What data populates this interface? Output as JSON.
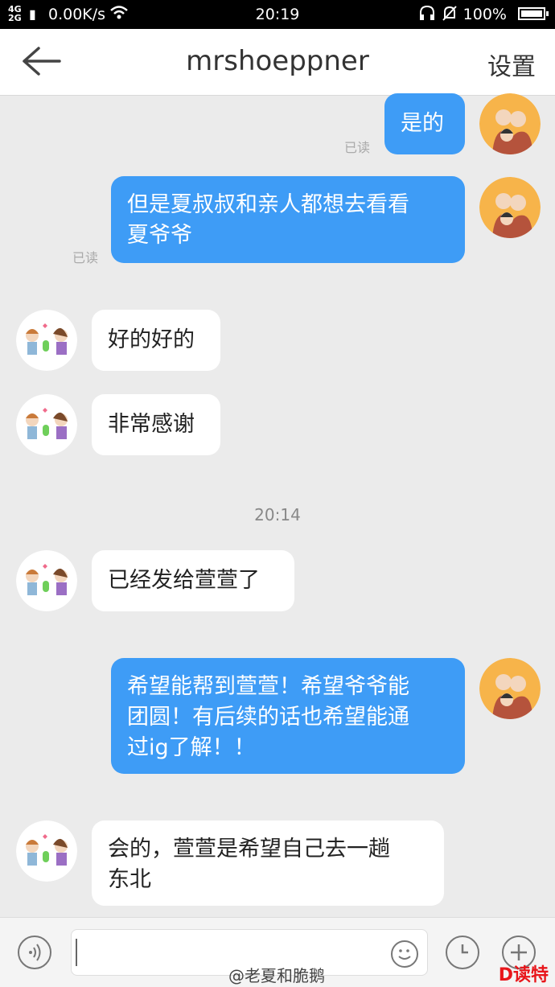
{
  "status_bar": {
    "network_top": "4G",
    "network_bottom": "2G",
    "speed": "0.00K/s",
    "time": "20:19",
    "battery": "100%"
  },
  "header": {
    "title": "mrshoeppner",
    "settings_label": "设置"
  },
  "messages": [
    {
      "text": "是的",
      "read": "已读"
    },
    {
      "text_line1": "但是夏叔叔和亲人都想去看看",
      "text_line2": "夏爷爷",
      "read": "已读"
    },
    {
      "text": "好的好的"
    },
    {
      "text": "非常感谢"
    },
    {
      "text": "已经发给萱萱了"
    },
    {
      "text_line1": "希望能帮到萱萱！希望爷爷能",
      "text_line2": "团圆！有后续的话也希望能通",
      "text_line3": "过ig了解！！"
    },
    {
      "text_line1": "会的，萱萱是希望自己去一趟",
      "text_line2": "东北"
    }
  ],
  "timestamp": "20:14",
  "watermark": "@老夏和脆鹅",
  "brand_logo": "D读特",
  "colors": {
    "outgoing_bubble": "#3e9cf6",
    "incoming_bubble": "#ffffff",
    "background": "#ebebeb"
  }
}
